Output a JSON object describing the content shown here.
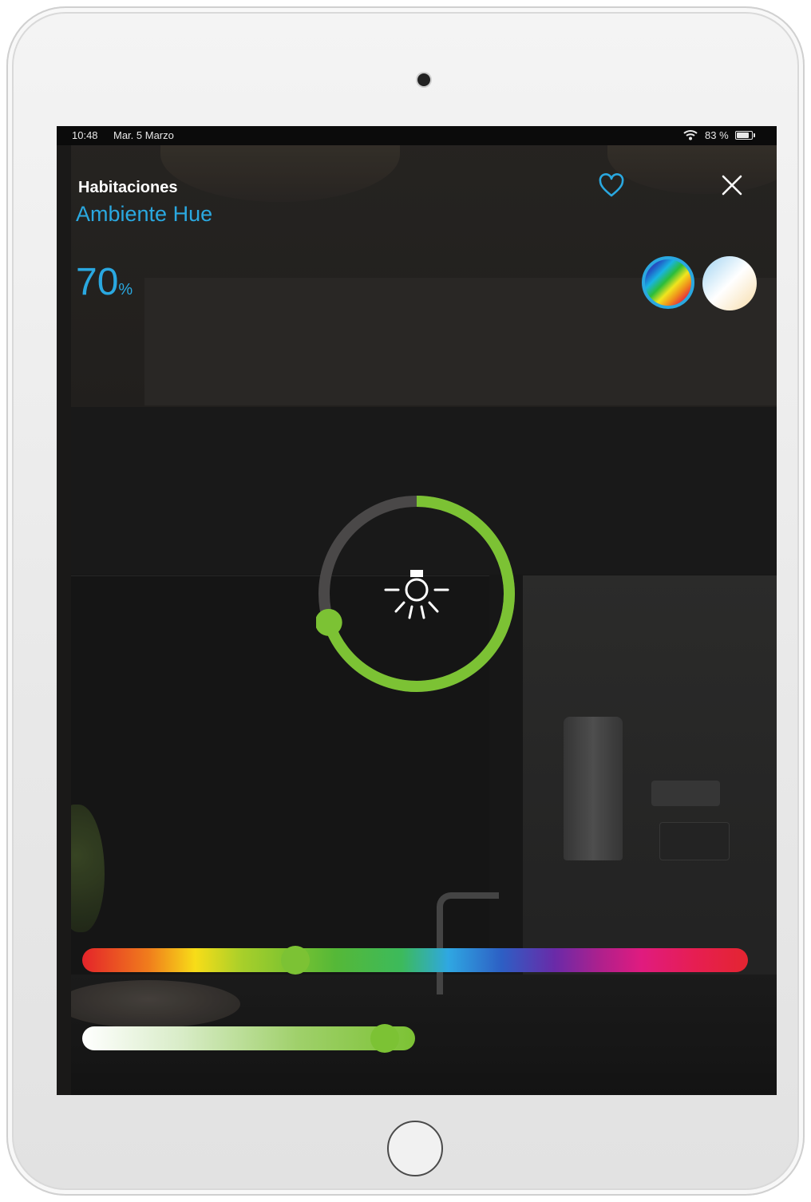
{
  "status_bar": {
    "time": "10:48",
    "date": "Mar. 5 Marzo",
    "battery": "83 %"
  },
  "header": {
    "room": "Habitaciones",
    "scene": "Ambiente Hue"
  },
  "brightness": {
    "value": "70",
    "unit": "%",
    "level": 0.7
  },
  "color_modes": [
    {
      "name": "color-mode",
      "selected": true
    },
    {
      "name": "white-mode",
      "selected": false
    }
  ],
  "sliders": {
    "hue_position": 0.32,
    "white_level": 0.91
  },
  "icons": {
    "favorite": "heart-icon",
    "close": "close-icon",
    "light": "bulb-icon"
  },
  "colors": {
    "accent": "#2aa8e0",
    "active": "#7cc234",
    "dial_track": "#4a4848"
  }
}
